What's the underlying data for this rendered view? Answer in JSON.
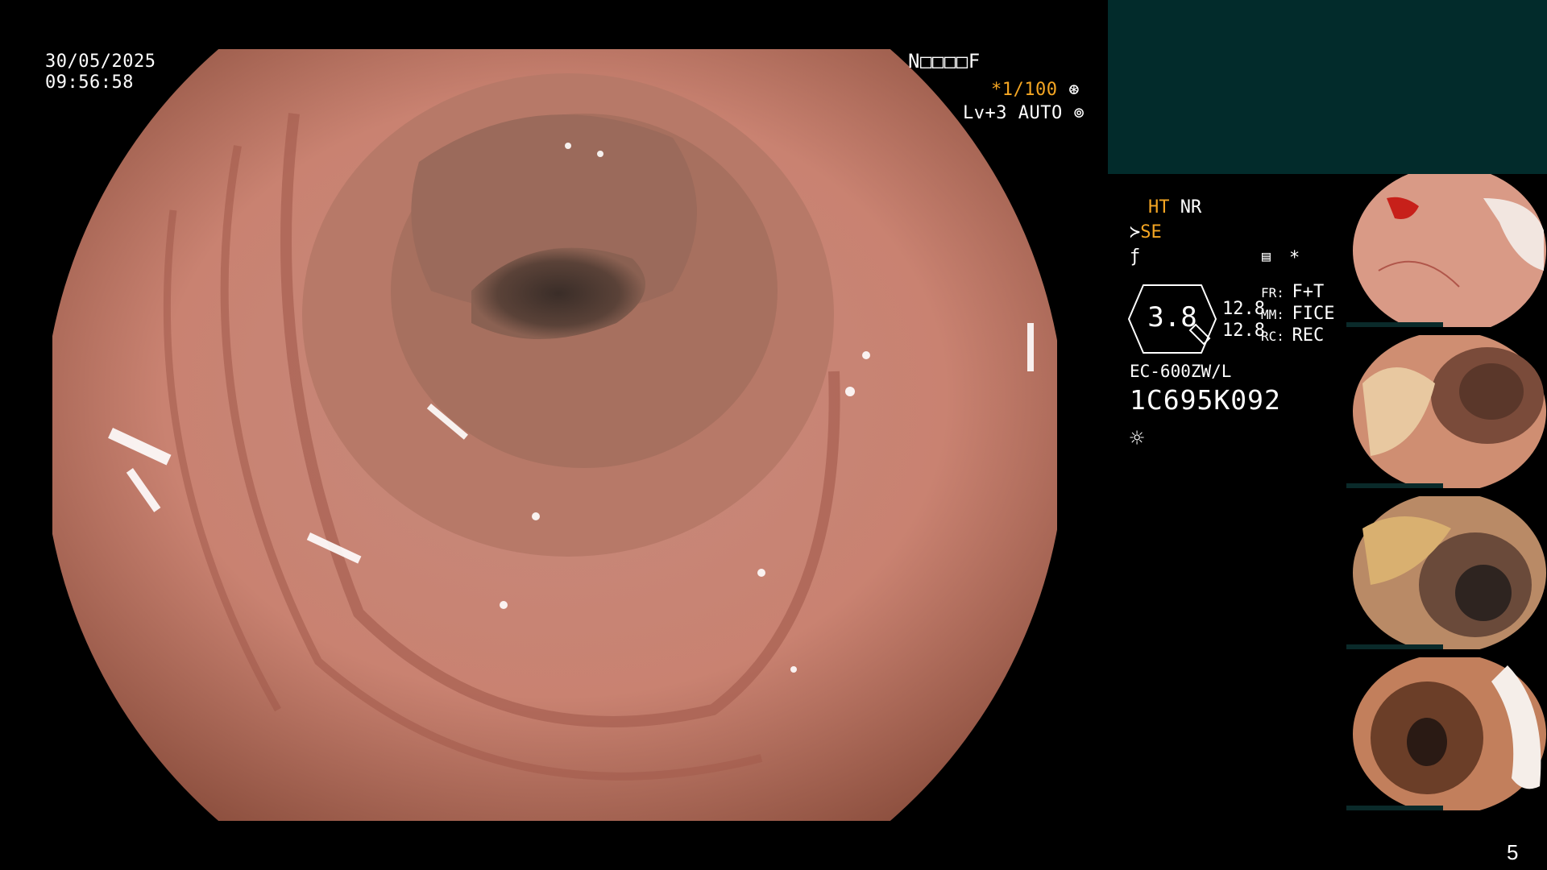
{
  "overlay": {
    "date": "30/05/2025",
    "time": "09:56:58",
    "patient_code": "N□□□□F",
    "shutter": "*1/100",
    "level": "Lv+3 AUTO"
  },
  "status": {
    "ht": "HT",
    "nr": "NR",
    "se": "SE",
    "zoom": "3.8",
    "val1": "12.8",
    "val2": "12.8",
    "fr_label": "FR:",
    "fr_value": "F+T",
    "mm_label": "MM:",
    "mm_value": "FICE",
    "rc_label": "RC:",
    "rc_value": "REC",
    "scope_model": "EC-600ZW/L",
    "serial": "1C695K092",
    "star": "*"
  },
  "page_number": "5",
  "icons": [
    "shutter-wheel-icon",
    "auto-wheel-icon",
    "structure-enhance-icon",
    "filter-icon",
    "memory-card-icon",
    "zoom-lens-icon",
    "light-sun-icon"
  ],
  "colors": {
    "background": "#000000",
    "panel": "#022b2b",
    "accent": "#f5a623",
    "mucosa": "#c98475"
  }
}
